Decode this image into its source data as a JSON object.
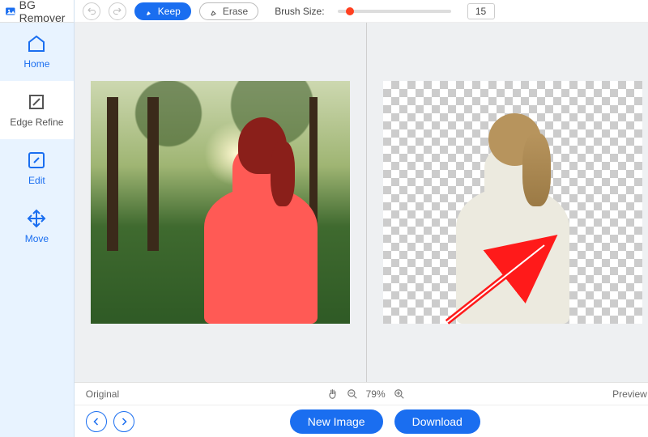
{
  "app_title": "BG Remover",
  "sidebar": {
    "items": [
      {
        "label": "Home",
        "icon": "home-icon"
      },
      {
        "label": "Edge Refine",
        "icon": "edge-refine-icon"
      },
      {
        "label": "Edit",
        "icon": "edit-icon"
      },
      {
        "label": "Move",
        "icon": "move-icon"
      }
    ],
    "active_index": 1
  },
  "toolbar": {
    "keep_label": "Keep",
    "erase_label": "Erase",
    "brush_label": "Brush Size:",
    "brush_value": "15"
  },
  "footer": {
    "original_label": "Original",
    "preview_label": "Preview",
    "zoom_percent": "79%",
    "new_image_label": "New Image",
    "download_label": "Download"
  }
}
